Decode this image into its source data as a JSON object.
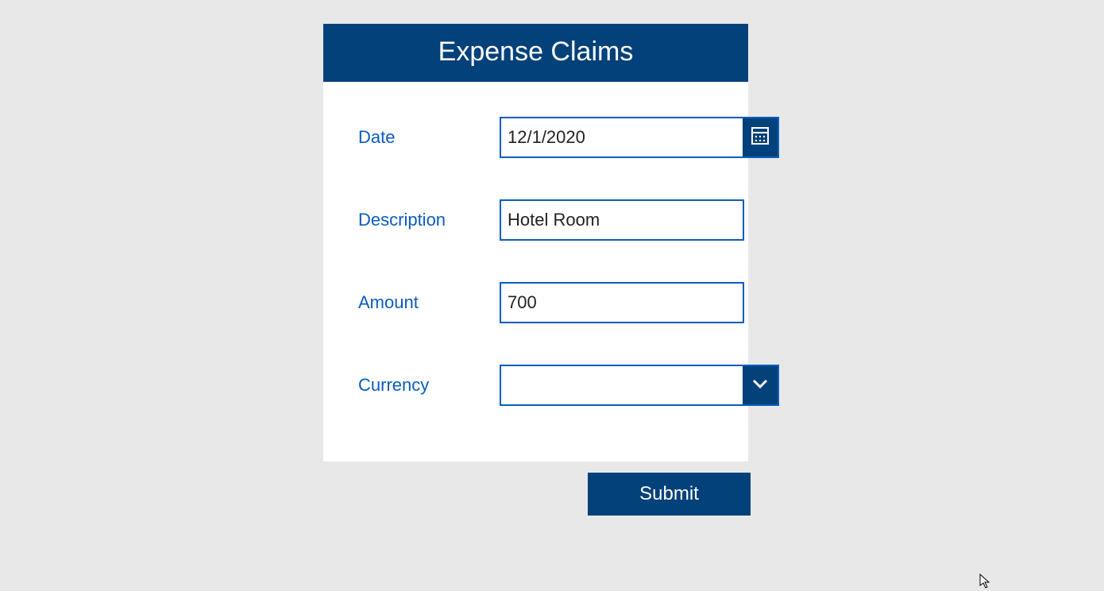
{
  "header": {
    "title": "Expense Claims"
  },
  "form": {
    "date": {
      "label": "Date",
      "value": "12/1/2020"
    },
    "description": {
      "label": "Description",
      "value": "Hotel Room"
    },
    "amount": {
      "label": "Amount",
      "value": "700"
    },
    "currency": {
      "label": "Currency",
      "value": ""
    }
  },
  "actions": {
    "submit": "Submit"
  },
  "colors": {
    "brand": "#03417a",
    "accent": "#0a5cc0",
    "bg": "#e8e8e8"
  }
}
